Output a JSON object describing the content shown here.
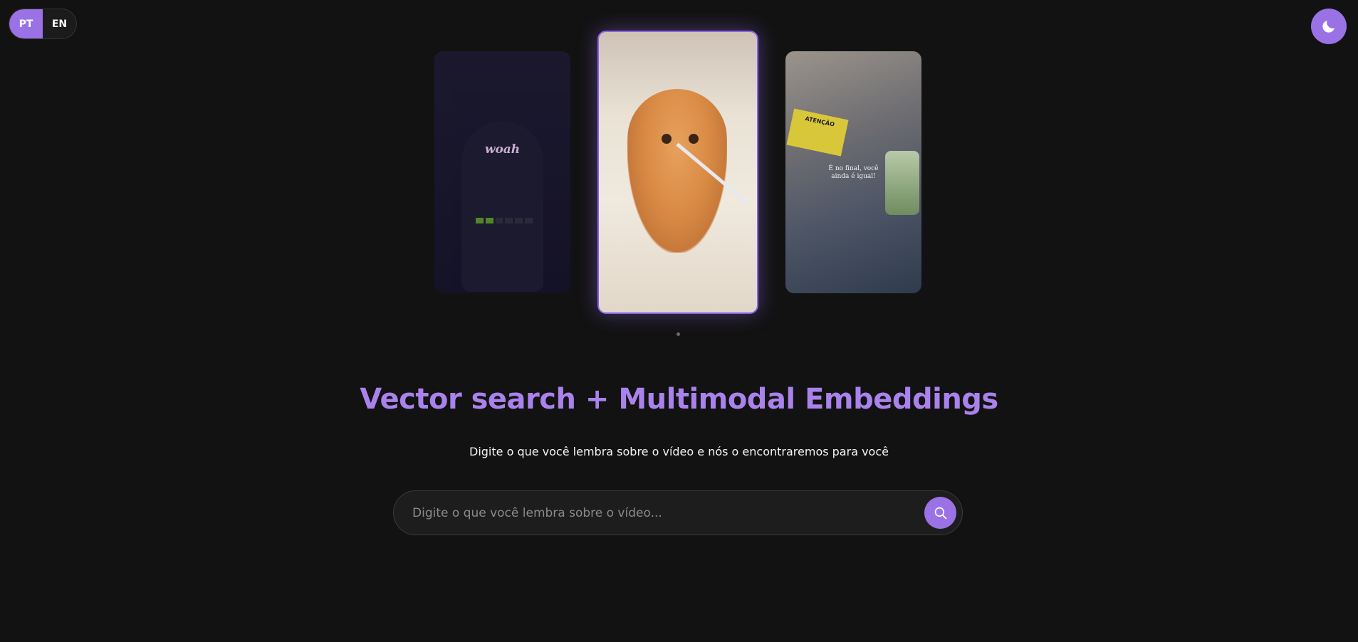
{
  "language_toggle": {
    "options": [
      {
        "label": "PT",
        "active": true
      },
      {
        "label": "EN",
        "active": false
      }
    ]
  },
  "theme_toggle": {
    "icon": "moon-icon",
    "mode": "dark"
  },
  "carousel": {
    "cards": [
      {
        "position": "left",
        "overlay_text": "woah"
      },
      {
        "position": "center",
        "selected": true
      },
      {
        "position": "right",
        "overlay_text": "É no final, você ainda é igual!",
        "sign_text": "ATENÇÃO"
      }
    ]
  },
  "hero": {
    "title": "Vector search + Multimodal Embeddings",
    "subtitle": "Digite o que você lembra sobre o vídeo e nós o encontraremos para você"
  },
  "search": {
    "value": "",
    "placeholder": "Digite o que você lembra sobre o vídeo...",
    "button_icon": "search-icon"
  },
  "colors": {
    "background": "#121212",
    "accent": "#9b72e6",
    "title": "#a982ec",
    "text": "#f4f4f4"
  }
}
